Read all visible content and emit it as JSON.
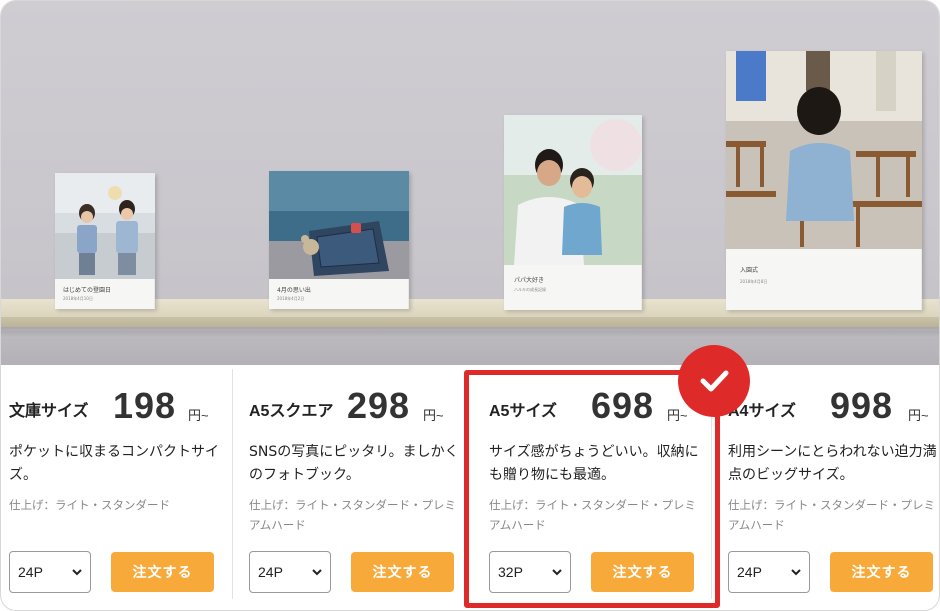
{
  "books": [
    {
      "title": "はじめての登園日",
      "subtitle": "2018年4月10日"
    },
    {
      "title": "4月の思い出",
      "subtitle": "2018年4月2日"
    },
    {
      "title": "パパ大好き",
      "subtitle": "ハルキの成長記録"
    },
    {
      "title": "入園式",
      "subtitle": "2018年4月8日"
    }
  ],
  "products": [
    {
      "size": "文庫サイズ",
      "price": "198",
      "unit": "円~",
      "description": "ポケットに収まるコンパクトサイズ。",
      "finish": "仕上げ：ライト・スタンダード",
      "pages": "24P",
      "order": "注文する",
      "selected": false
    },
    {
      "size": "A5スクエア",
      "price": "298",
      "unit": "円~",
      "description": "SNSの写真にピッタリ。ましかくのフォトブック。",
      "finish": "仕上げ：ライト・スタンダード・プレミアムハード",
      "pages": "24P",
      "order": "注文する",
      "selected": false
    },
    {
      "size": "A5サイズ",
      "price": "698",
      "unit": "円~",
      "description": "サイズ感がちょうどいい。収納にも贈り物にも最適。",
      "finish": "仕上げ：ライト・スタンダード・プレミアムハード",
      "pages": "32P",
      "order": "注文する",
      "selected": true
    },
    {
      "size": "A4サイズ",
      "price": "998",
      "unit": "円~",
      "description": "利用シーンにとらわれない迫力満点のビッグサイズ。",
      "finish": "仕上げ：ライト・スタンダード・プレミアムハード",
      "pages": "24P",
      "order": "注文する",
      "selected": false
    }
  ],
  "colors": {
    "accent_orange": "#f7a93a",
    "selection_red": "#df2a2a"
  },
  "icons": {
    "select_chevron": "chevron-down-icon",
    "selected_badge": "check-icon"
  }
}
